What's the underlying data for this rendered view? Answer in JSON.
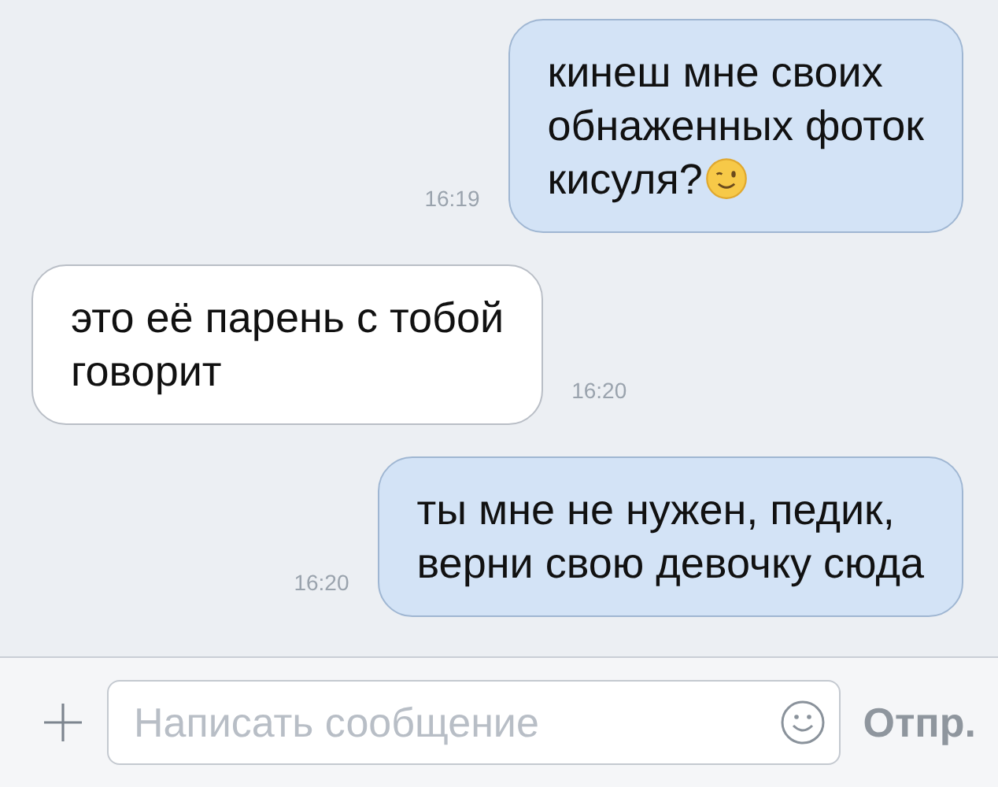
{
  "messages": [
    {
      "kind": "outgoing",
      "text": "кинеш мне своих\nобнаженных фоток\nкисуля?",
      "wink_emoji": true,
      "time": "16:19"
    },
    {
      "kind": "incoming",
      "text": "это её парень с тобой\nговорит",
      "time": "16:20"
    },
    {
      "kind": "outgoing",
      "text": "ты мне не нужен, педик,\nверни свою девочку сюда",
      "time": "16:20"
    }
  ],
  "composer": {
    "placeholder": "Написать сообщение",
    "send": "Отпр."
  }
}
